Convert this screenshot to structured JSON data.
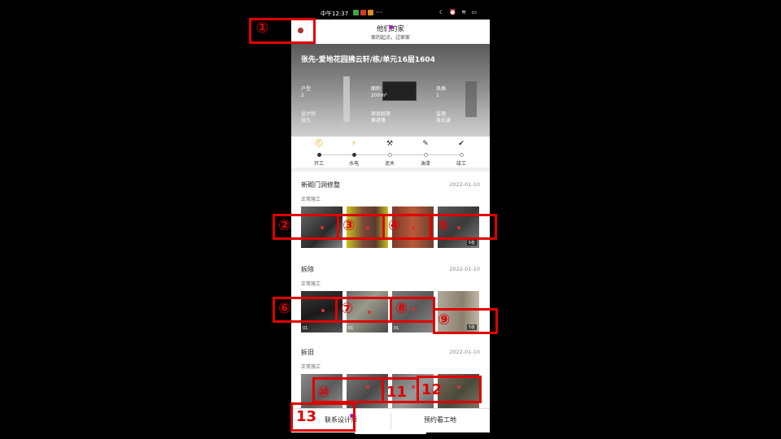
{
  "status_bar": {
    "time": "中午12:37",
    "dots": "···"
  },
  "header": {
    "title": "他们的家",
    "subtitle": "家的起点，过家家"
  },
  "hero": {
    "address": "张先-爱地花园拂云轩/栋/单元16层1604",
    "info": [
      {
        "label": "户型",
        "value": "2"
      },
      {
        "label": "面积",
        "value": "200m²"
      },
      {
        "label": "风格",
        "value": "1"
      },
      {
        "label": "设计师",
        "value": "张凡"
      },
      {
        "label": "项目经理",
        "value": "章进锋"
      },
      {
        "label": "监理",
        "value": "张长波"
      }
    ]
  },
  "progress": {
    "stages": [
      {
        "label": "开工",
        "icon": "helmet-icon",
        "done": true
      },
      {
        "label": "水电",
        "icon": "plug-icon",
        "done": true
      },
      {
        "label": "泥木",
        "icon": "hammer-icon",
        "done": false
      },
      {
        "label": "油漆",
        "icon": "brush-icon",
        "done": false
      },
      {
        "label": "竣工",
        "icon": "check-icon",
        "done": false
      }
    ]
  },
  "sections": [
    {
      "title": "新砌门洞修整",
      "date": "2022-01-10",
      "status": "正常施工",
      "thumbs": [
        {
          "tag": ""
        },
        {
          "tag": ""
        },
        {
          "tag": ""
        },
        {
          "tag": "",
          "count": "5张"
        }
      ]
    },
    {
      "title": "拆除",
      "date": "2022-01-10",
      "status": "正常施工",
      "thumbs": [
        {
          "tag": "01"
        },
        {
          "tag": "01"
        },
        {
          "tag": "01"
        },
        {
          "tag": "",
          "count": "5张"
        }
      ]
    },
    {
      "title": "拆旧",
      "date": "2022-01-10",
      "status": "正常施工",
      "thumbs": [
        {
          "tag": "01"
        },
        {
          "tag": ""
        },
        {
          "tag": ""
        },
        {
          "tag": ""
        }
      ]
    }
  ],
  "bottom": {
    "contact": "联系设计师",
    "book": "预约看工地"
  },
  "annotations": [
    "①",
    "②",
    "③",
    "④",
    "⑤",
    "⑥",
    "⑦",
    "⑧",
    "⑨",
    "⑩",
    "11",
    "12",
    "13"
  ],
  "colors": {
    "annotation": "#e00000",
    "back_dot": "#b0302a",
    "marker": "#a020c0"
  }
}
